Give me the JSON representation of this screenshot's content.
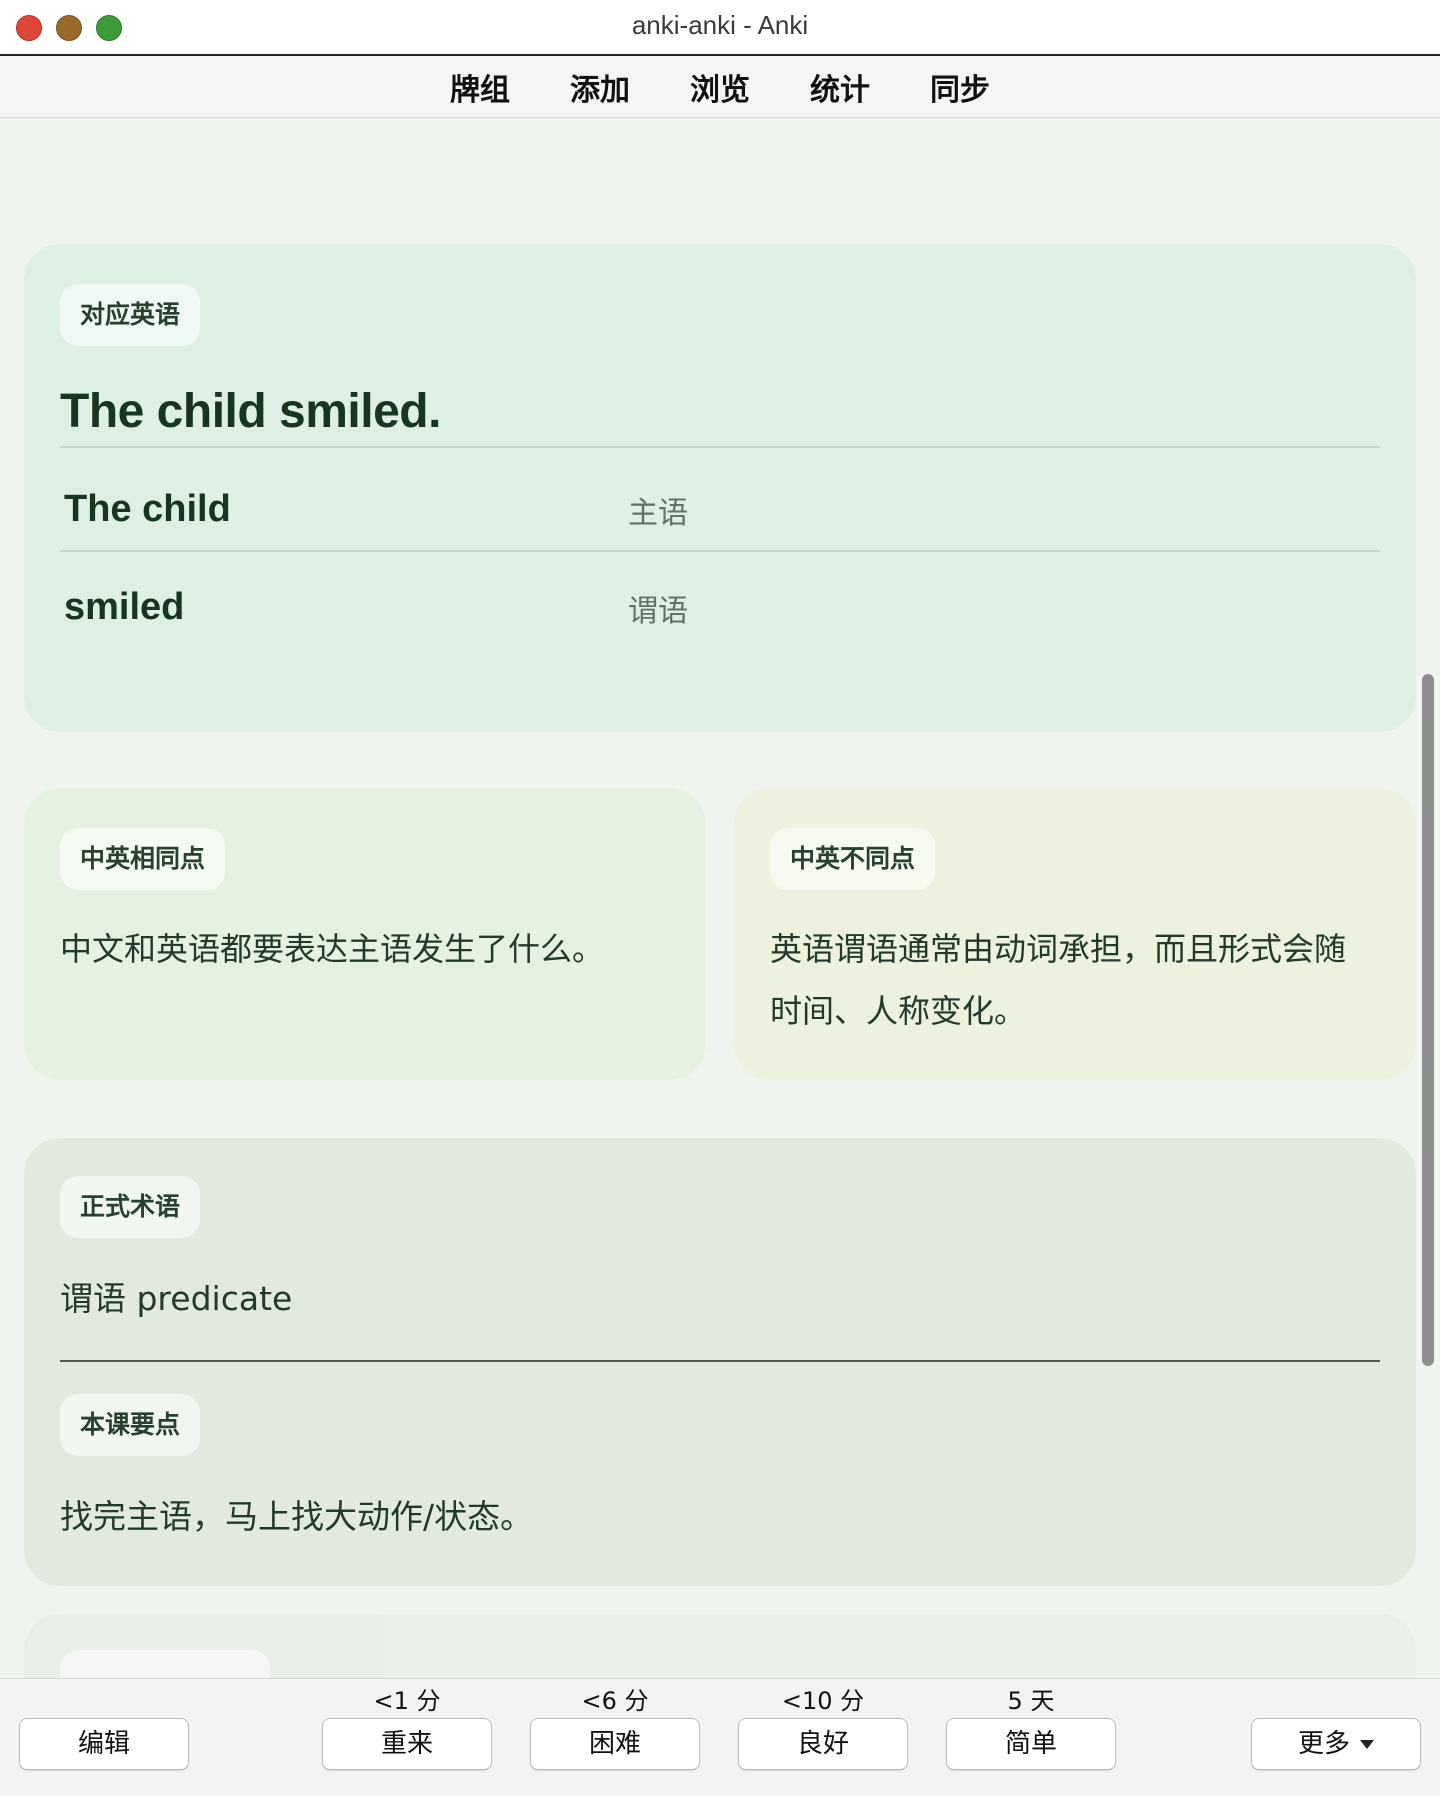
{
  "window": {
    "title": "anki-anki - Anki"
  },
  "toolbar": {
    "tabs": [
      "牌组",
      "添加",
      "浏览",
      "统计",
      "同步"
    ]
  },
  "card": {
    "main": {
      "label": "对应英语",
      "sentence": "The child smiled.",
      "rows": [
        {
          "word": "The child",
          "role": "主语"
        },
        {
          "word": "smiled",
          "role": "谓语"
        }
      ]
    },
    "same": {
      "label": "中英相同点",
      "text": "中文和英语都要表达主语发生了什么。"
    },
    "diff": {
      "label": "中英不同点",
      "text": "英语谓语通常由动词承担，而且形式会随时间、人称变化。"
    },
    "terms": {
      "label": "正式术语",
      "text": "谓语 predicate",
      "key_label": "本课要点",
      "key_text": "找完主语，马上找大动作/状态。"
    }
  },
  "answer_bar": {
    "edit_label": "编辑",
    "more_label": "更多",
    "buttons": [
      {
        "label": "重来",
        "interval": "<1 分"
      },
      {
        "label": "困难",
        "interval": "<6 分"
      },
      {
        "label": "良好",
        "interval": "<10 分"
      },
      {
        "label": "简单",
        "interval": "5 天"
      }
    ]
  }
}
